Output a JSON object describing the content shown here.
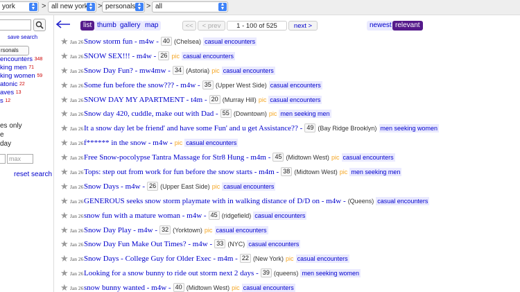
{
  "topbar": {
    "location_select": "york",
    "area_select": "all new york",
    "category_select": "personals",
    "subcategory_select": "all",
    "separator": ">"
  },
  "sidebar": {
    "save_search": "save search",
    "category_select": "rsonals",
    "categories": [
      {
        "label": "encounters",
        "count": "348"
      },
      {
        "label": "king men",
        "count": "71"
      },
      {
        "label": "king women",
        "count": "59"
      },
      {
        "label": "atonic",
        "count": "22"
      },
      {
        "label": "aves",
        "count": "13"
      },
      {
        "label": "s",
        "count": "12"
      }
    ],
    "options": [
      "es only",
      "e",
      "day"
    ],
    "price_max_placeholder": "max",
    "reset_search": "reset search"
  },
  "toolbar": {
    "views": [
      "list",
      "thumb",
      "gallery",
      "map"
    ],
    "active_view": "list",
    "first": "<<",
    "prev": "< prev",
    "range": "1 - 100 of 525",
    "next": "next >",
    "sort_newest": "newest",
    "sort_relevant": "relevant"
  },
  "listings": [
    {
      "date": "Jan 26",
      "title": "Snow storm fun - m4w -",
      "age": "40",
      "hood": "(Chelsea)",
      "pic": "",
      "category": "casual encounters"
    },
    {
      "date": "Jan 26",
      "title": "SNOW SEX!!! - m4w -",
      "age": "26",
      "hood": "",
      "pic": "pic",
      "category": "casual encounters"
    },
    {
      "date": "Jan 26",
      "title": "Snow Day Fun? - mw4mw -",
      "age": "34",
      "hood": "(Astoria)",
      "pic": "pic",
      "category": "casual encounters"
    },
    {
      "date": "Jan 26",
      "title": "Some fun before the snow??? - m4w -",
      "age": "35",
      "hood": "(Upper West Side)",
      "pic": "",
      "category": "casual encounters"
    },
    {
      "date": "Jan 26",
      "title": "SNOW DAY MY APARTMENT - t4m -",
      "age": "20",
      "hood": "(Murray Hill)",
      "pic": "pic",
      "category": "casual encounters"
    },
    {
      "date": "Jan 26",
      "title": "Snow day 420, cuddle, make out with Dad -",
      "age": "55",
      "hood": "(Downtown)",
      "pic": "pic",
      "category": "men seeking men"
    },
    {
      "date": "Jan 26",
      "title": "It a snow day let be friend' and have some Fun' and u get Assistance?? -",
      "age": "49",
      "hood": "(Bay Ridge Brooklyn)",
      "pic": "",
      "category": "men seeking women"
    },
    {
      "date": "Jan 26",
      "title": "f****** in the snow - m4w -",
      "age": "",
      "hood": "",
      "pic": "pic",
      "category": "casual encounters"
    },
    {
      "date": "Jan 26",
      "title": "Free Snow-pocolypse Tantra Massage for Str8 Hung - m4m -",
      "age": "45",
      "hood": "(Midtown West)",
      "pic": "pic",
      "category": "casual encounters"
    },
    {
      "date": "Jan 26",
      "title": "Tops: step out from work for fun before the snow starts - m4m -",
      "age": "38",
      "hood": "(Midtown West)",
      "pic": "pic",
      "category": "men seeking men"
    },
    {
      "date": "Jan 26",
      "title": "Snow Days - m4w -",
      "age": "26",
      "hood": "(Upper East Side)",
      "pic": "pic",
      "category": "casual encounters"
    },
    {
      "date": "Jan 26",
      "title": "GENEROUS seeks snow storm playmate with in walking distance of D/D on - m4w -",
      "age": "",
      "hood": "(Queens)",
      "pic": "",
      "category": "casual encounters"
    },
    {
      "date": "Jan 26",
      "title": "snow fun with a mature woman - m4w -",
      "age": "45",
      "hood": "(ridgefield)",
      "pic": "",
      "category": "casual encounters"
    },
    {
      "date": "Jan 26",
      "title": "Snow Day Play - m4w -",
      "age": "32",
      "hood": "(Yorktown)",
      "pic": "pic",
      "category": "casual encounters"
    },
    {
      "date": "Jan 26",
      "title": "Snow Day Fun Make Out Times? - m4w -",
      "age": "33",
      "hood": "(NYC)",
      "pic": "",
      "category": "casual encounters"
    },
    {
      "date": "Jan 26",
      "title": "Snow Days - College Guy for Older Exec - m4m -",
      "age": "22",
      "hood": "(New York)",
      "pic": "pic",
      "category": "casual encounters"
    },
    {
      "date": "Jan 26",
      "title": "Looking for a snow bunny to ride out storm next 2 days -",
      "age": "39",
      "hood": "(queens)",
      "pic": "",
      "category": "men seeking women"
    },
    {
      "date": "Jan 26",
      "title": "snow bunny wanted - m4w -",
      "age": "40",
      "hood": "(Midtown West)",
      "pic": "pic",
      "category": "casual encounters"
    }
  ]
}
